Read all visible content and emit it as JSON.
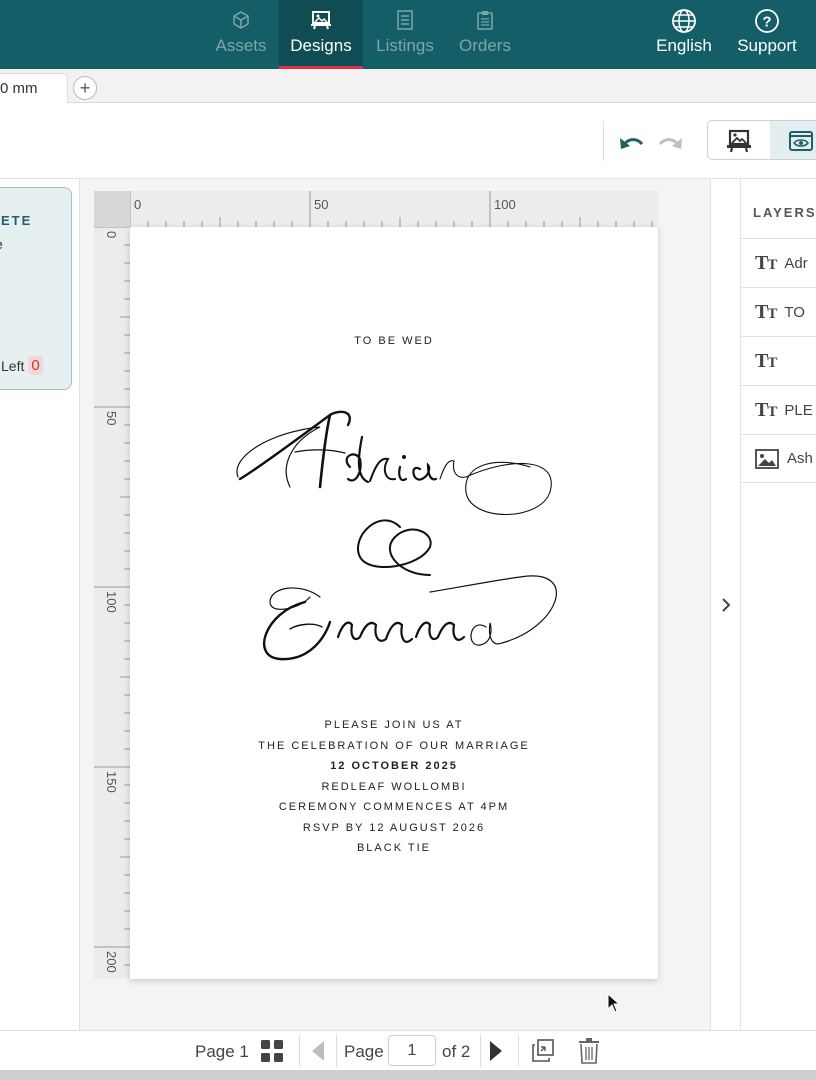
{
  "nav": {
    "tabs": [
      {
        "label": "Assets",
        "icon": "cube-icon"
      },
      {
        "label": "Designs",
        "icon": "design-board-icon",
        "active": true
      },
      {
        "label": "Listings",
        "icon": "list-doc-icon"
      },
      {
        "label": "Orders",
        "icon": "clipboard-icon"
      }
    ],
    "language": "English",
    "support": "Support",
    "colors": {
      "bar": "#145f67",
      "active": "#0f4c53",
      "accent": "#e0334a"
    }
  },
  "tabstrip": {
    "doc_tab": "0 mm"
  },
  "left_panel": {
    "title": "ETE",
    "subtitle": "e",
    "left_label": "Left",
    "left_count": "0"
  },
  "ruler": {
    "h_labels": [
      "0",
      "50",
      "100"
    ],
    "v_labels": [
      "0",
      "50",
      "100",
      "150",
      "200"
    ]
  },
  "invitation": {
    "intro": "TO BE WED",
    "details": [
      {
        "text": "PLEASE JOIN US AT",
        "bold": false
      },
      {
        "text": "THE CELEBRATION OF OUR MARRIAGE",
        "bold": false
      },
      {
        "text": "12 OCTOBER 2025",
        "bold": true
      },
      {
        "text": "REDLEAF WOLLOMBI",
        "bold": false
      },
      {
        "text": "CEREMONY COMMENCES AT 4PM",
        "bold": false
      },
      {
        "text": "RSVP BY 12 AUGUST 2026",
        "bold": false
      },
      {
        "text": "BLACK TIE",
        "bold": false
      }
    ]
  },
  "layers": {
    "title": "LAYERS",
    "items": [
      {
        "label": "Adr",
        "type": "text"
      },
      {
        "label": "TO",
        "type": "text"
      },
      {
        "label": "",
        "type": "text"
      },
      {
        "label": "PLE",
        "type": "text"
      },
      {
        "label": "Ash",
        "type": "image"
      }
    ]
  },
  "bottom": {
    "page_label": "Page 1",
    "page_prefix": "Page",
    "page_value": "1",
    "page_total": "of 2"
  }
}
